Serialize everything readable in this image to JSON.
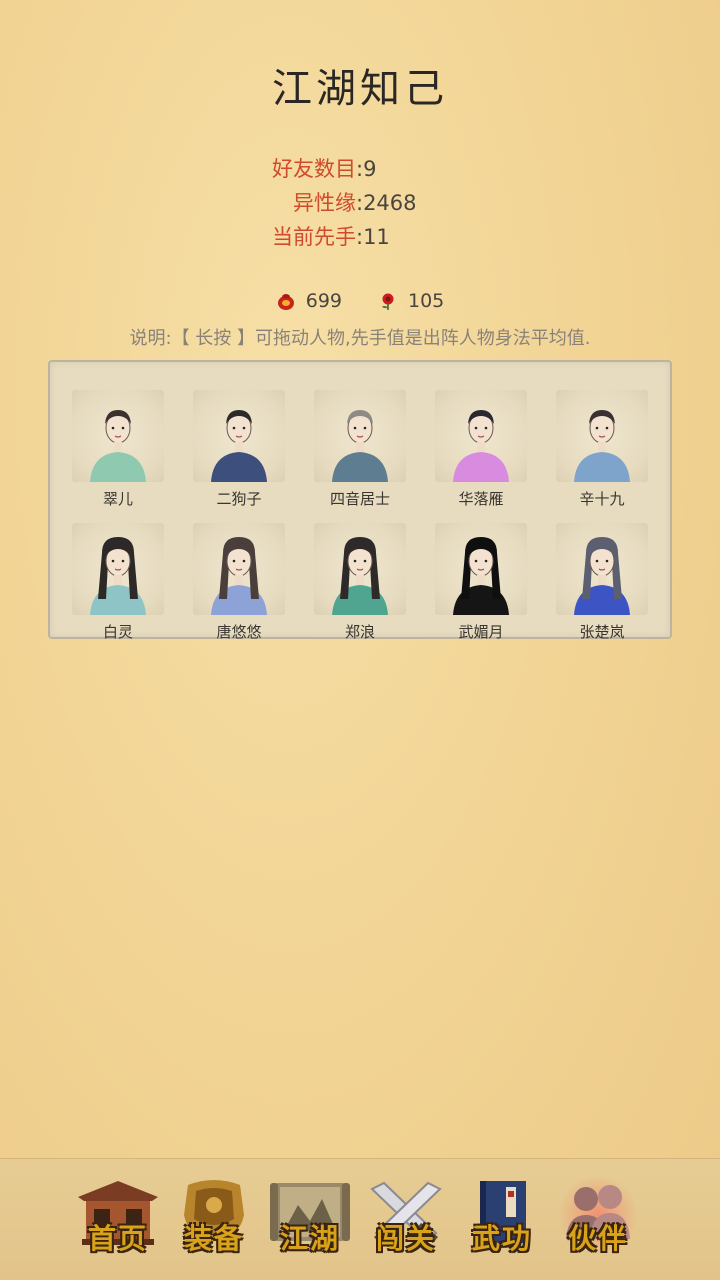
{
  "title": "江湖知己",
  "stats": [
    {
      "label": "好友数目",
      "value": ":9"
    },
    {
      "label": "异性缘",
      "value": ":2468"
    },
    {
      "label": "当前先手",
      "value": ":11"
    }
  ],
  "resources": [
    {
      "icon": "red-pouch-icon",
      "value": "699"
    },
    {
      "icon": "red-rose-icon",
      "value": "105"
    }
  ],
  "note": "说明:【 长按 】可拖动人物,先手值是出阵人物身法平均值.",
  "characters": [
    {
      "name": "翠儿",
      "robe": "#8fc9b0",
      "hair": "#3b3230"
    },
    {
      "name": "二狗子",
      "robe": "#3d4f7c",
      "hair": "#2e2a28"
    },
    {
      "name": "四音居士",
      "robe": "#5f7d90",
      "hair": "#8e8a86"
    },
    {
      "name": "华落雁",
      "robe": "#d98be0",
      "hair": "#2a2730"
    },
    {
      "name": "辛十九",
      "robe": "#7ea4cc",
      "hair": "#3a3230"
    },
    {
      "name": "白灵",
      "robe": "#8fc4c6",
      "hair": "#2d2928"
    },
    {
      "name": "唐悠悠",
      "robe": "#8da2d6",
      "hair": "#4a3f3a"
    },
    {
      "name": "郑浪",
      "robe": "#4fa58f",
      "hair": "#2e2a2a"
    },
    {
      "name": "武媚月",
      "robe": "#151515",
      "hair": "#0f0f0f"
    },
    {
      "name": "张楚岚",
      "robe": "#3c54c4",
      "hair": "#5b5f6f"
    }
  ],
  "nav": [
    {
      "label": "首页",
      "icon": "house-icon",
      "active": false
    },
    {
      "label": "装备",
      "icon": "armor-icon",
      "active": false
    },
    {
      "label": "江湖",
      "icon": "scroll-map-icon",
      "active": false
    },
    {
      "label": "闯关",
      "icon": "crossed-swords-icon",
      "active": false
    },
    {
      "label": "武功",
      "icon": "book-icon",
      "active": false
    },
    {
      "label": "伙伴",
      "icon": "partners-icon",
      "active": true
    }
  ]
}
